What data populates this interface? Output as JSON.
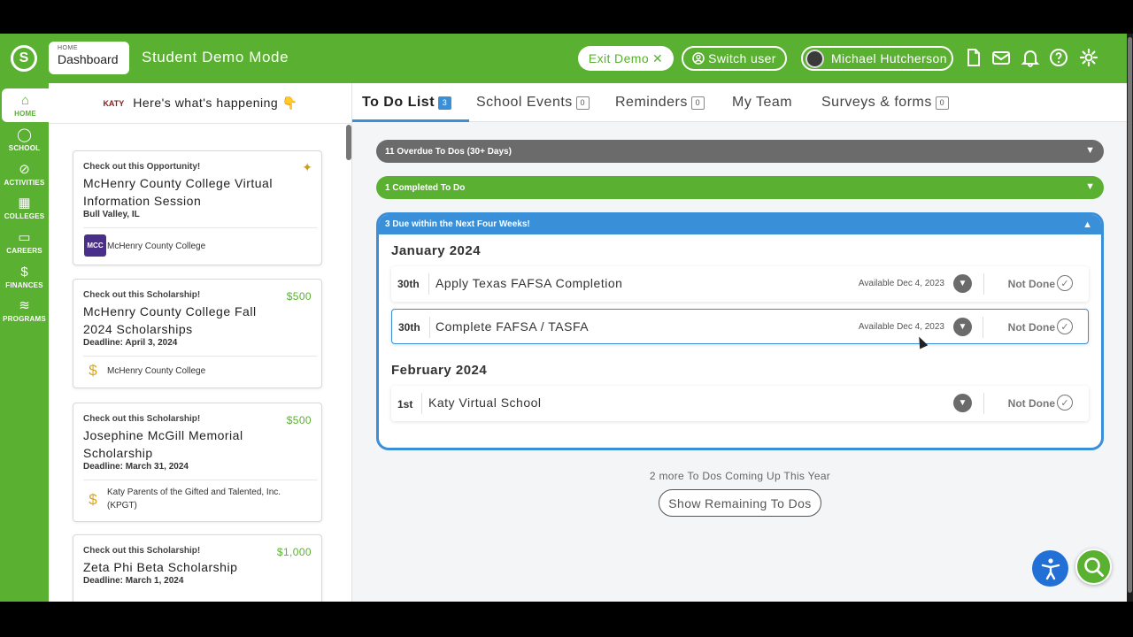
{
  "header": {
    "breadcrumb_small": "HOME",
    "breadcrumb_page": "Dashboard",
    "mode_title": "Student Demo Mode",
    "exit_demo": "Exit Demo",
    "switch_user": "Switch user",
    "user_name": "Michael Hutcherson",
    "icons": [
      "document-icon",
      "mail-icon",
      "bell-icon",
      "help-icon",
      "gear-icon"
    ]
  },
  "sidenav": {
    "items": [
      {
        "label": "HOME",
        "icon": "home-icon",
        "active": true
      },
      {
        "label": "SCHOOL",
        "icon": "apple-icon"
      },
      {
        "label": "ACTIVITIES",
        "icon": "compass-icon"
      },
      {
        "label": "COLLEGES",
        "icon": "building-icon"
      },
      {
        "label": "CAREERS",
        "icon": "briefcase-icon"
      },
      {
        "label": "FINANCES",
        "icon": "money-bag-icon"
      },
      {
        "label": "PROGRAMS",
        "icon": "programs-icon"
      }
    ]
  },
  "feed": {
    "title": "Here's what's happening 👇",
    "logo_text": "KATY",
    "cards": [
      {
        "type": "Check out this Opportunity!",
        "title": "McHenry County College Virtual Information Session",
        "sub": "Bull Valley, IL",
        "org": "McHenry County College",
        "org_badge": "MCC",
        "amount": ""
      },
      {
        "type": "Check out this Scholarship!",
        "title": "McHenry County College Fall 2024 Scholarships",
        "sub": "Deadline: April 3, 2024",
        "org": "McHenry County College",
        "amount": "$500"
      },
      {
        "type": "Check out this Scholarship!",
        "title": "Josephine McGill Memorial Scholarship",
        "sub": "Deadline: March 31, 2024",
        "org": "Katy Parents of the Gifted and Talented, Inc. (KPGT)",
        "amount": "$500"
      },
      {
        "type": "Check out this Scholarship!",
        "title": "Zeta Phi Beta Scholarship",
        "sub": "Deadline: March 1, 2024",
        "org": "",
        "amount": "$1,000"
      }
    ]
  },
  "tabs": [
    {
      "label": "To Do List",
      "count": "3",
      "active": true
    },
    {
      "label": "School Events",
      "count": "0"
    },
    {
      "label": "Reminders",
      "count": "0"
    },
    {
      "label": "My Team",
      "count": ""
    },
    {
      "label": "Surveys & forms",
      "count": "0"
    }
  ],
  "todos": {
    "overdue_label": "11 Overdue To Dos (30+ Days)",
    "completed_label": "1 Completed To Do",
    "due_label": "3 Due within the Next Four Weeks!",
    "months": [
      {
        "name": "January 2024",
        "items": [
          {
            "day": "30th",
            "title": "Apply Texas FAFSA Completion",
            "available": "Available Dec 4, 2023",
            "status": "Not Done"
          },
          {
            "day": "30th",
            "title": "Complete FAFSA / TASFA",
            "available": "Available Dec 4, 2023",
            "status": "Not Done"
          }
        ]
      },
      {
        "name": "February 2024",
        "items": [
          {
            "day": "1st",
            "title": "Katy Virtual School",
            "available": "",
            "status": "Not Done"
          }
        ]
      }
    ],
    "more_text": "2 more To Dos Coming Up This Year",
    "show_button": "Show Remaining To Dos"
  },
  "colors": {
    "brand_green": "#5ab030",
    "accent_blue": "#3a8fd9",
    "overdue_gray": "#6b6b6b"
  }
}
